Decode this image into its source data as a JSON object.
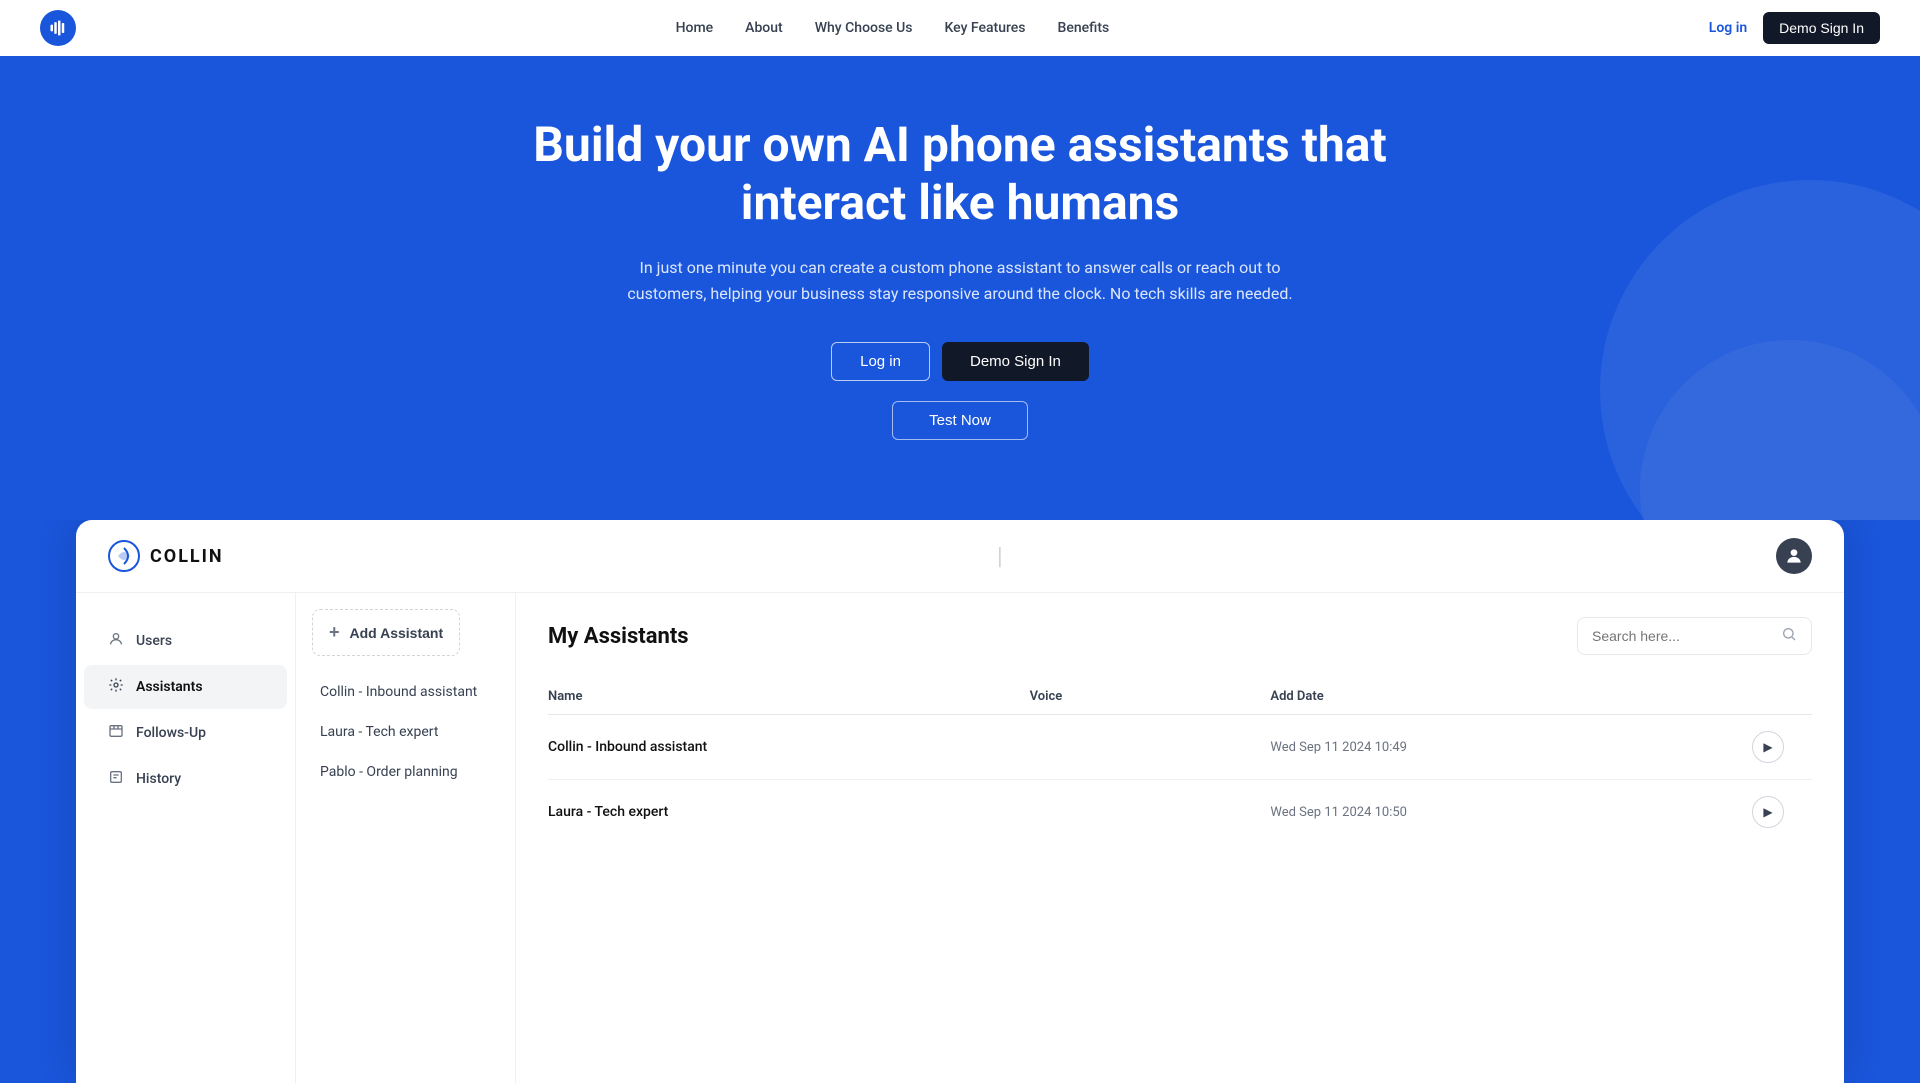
{
  "nav": {
    "logo_symbol": "♪",
    "links": [
      "Home",
      "About",
      "Why Choose Us",
      "Key Features",
      "Benefits"
    ],
    "login_label": "Log in",
    "demo_label": "Demo Sign In"
  },
  "hero": {
    "headline": "Build your own AI phone assistants that interact like humans",
    "subtext": "In just one minute you can create a custom phone assistant to answer calls or reach out to customers, helping your business stay responsive around the clock. No tech skills are needed.",
    "btn_login": "Log in",
    "btn_demo": "Demo Sign In",
    "btn_test": "Test Now"
  },
  "app": {
    "logo_text": "COLLIN",
    "logo_symbol": "◑",
    "header_divider": "|",
    "sidebar": {
      "items": [
        {
          "label": "Users",
          "icon": "👤"
        },
        {
          "label": "Assistants",
          "icon": "🎙",
          "active": true
        },
        {
          "label": "Follows-Up",
          "icon": "🔁"
        },
        {
          "label": "History",
          "icon": "📄"
        }
      ]
    },
    "assistant_list": {
      "add_btn": "Add Assistant",
      "items": [
        {
          "label": "Collin - Inbound assistant"
        },
        {
          "label": "Laura - Tech expert"
        },
        {
          "label": "Pablo - Order planning"
        }
      ]
    },
    "main": {
      "title": "My Assistants",
      "search_placeholder": "Search here...",
      "table": {
        "columns": [
          "Name",
          "Voice",
          "Add Date"
        ],
        "rows": [
          {
            "name": "Collin - Inbound assistant",
            "voice": "",
            "date": "Wed Sep 11 2024  10:49"
          },
          {
            "name": "Laura - Tech expert",
            "voice": "",
            "date": "Wed Sep 11 2024  10:50"
          }
        ]
      }
    }
  }
}
